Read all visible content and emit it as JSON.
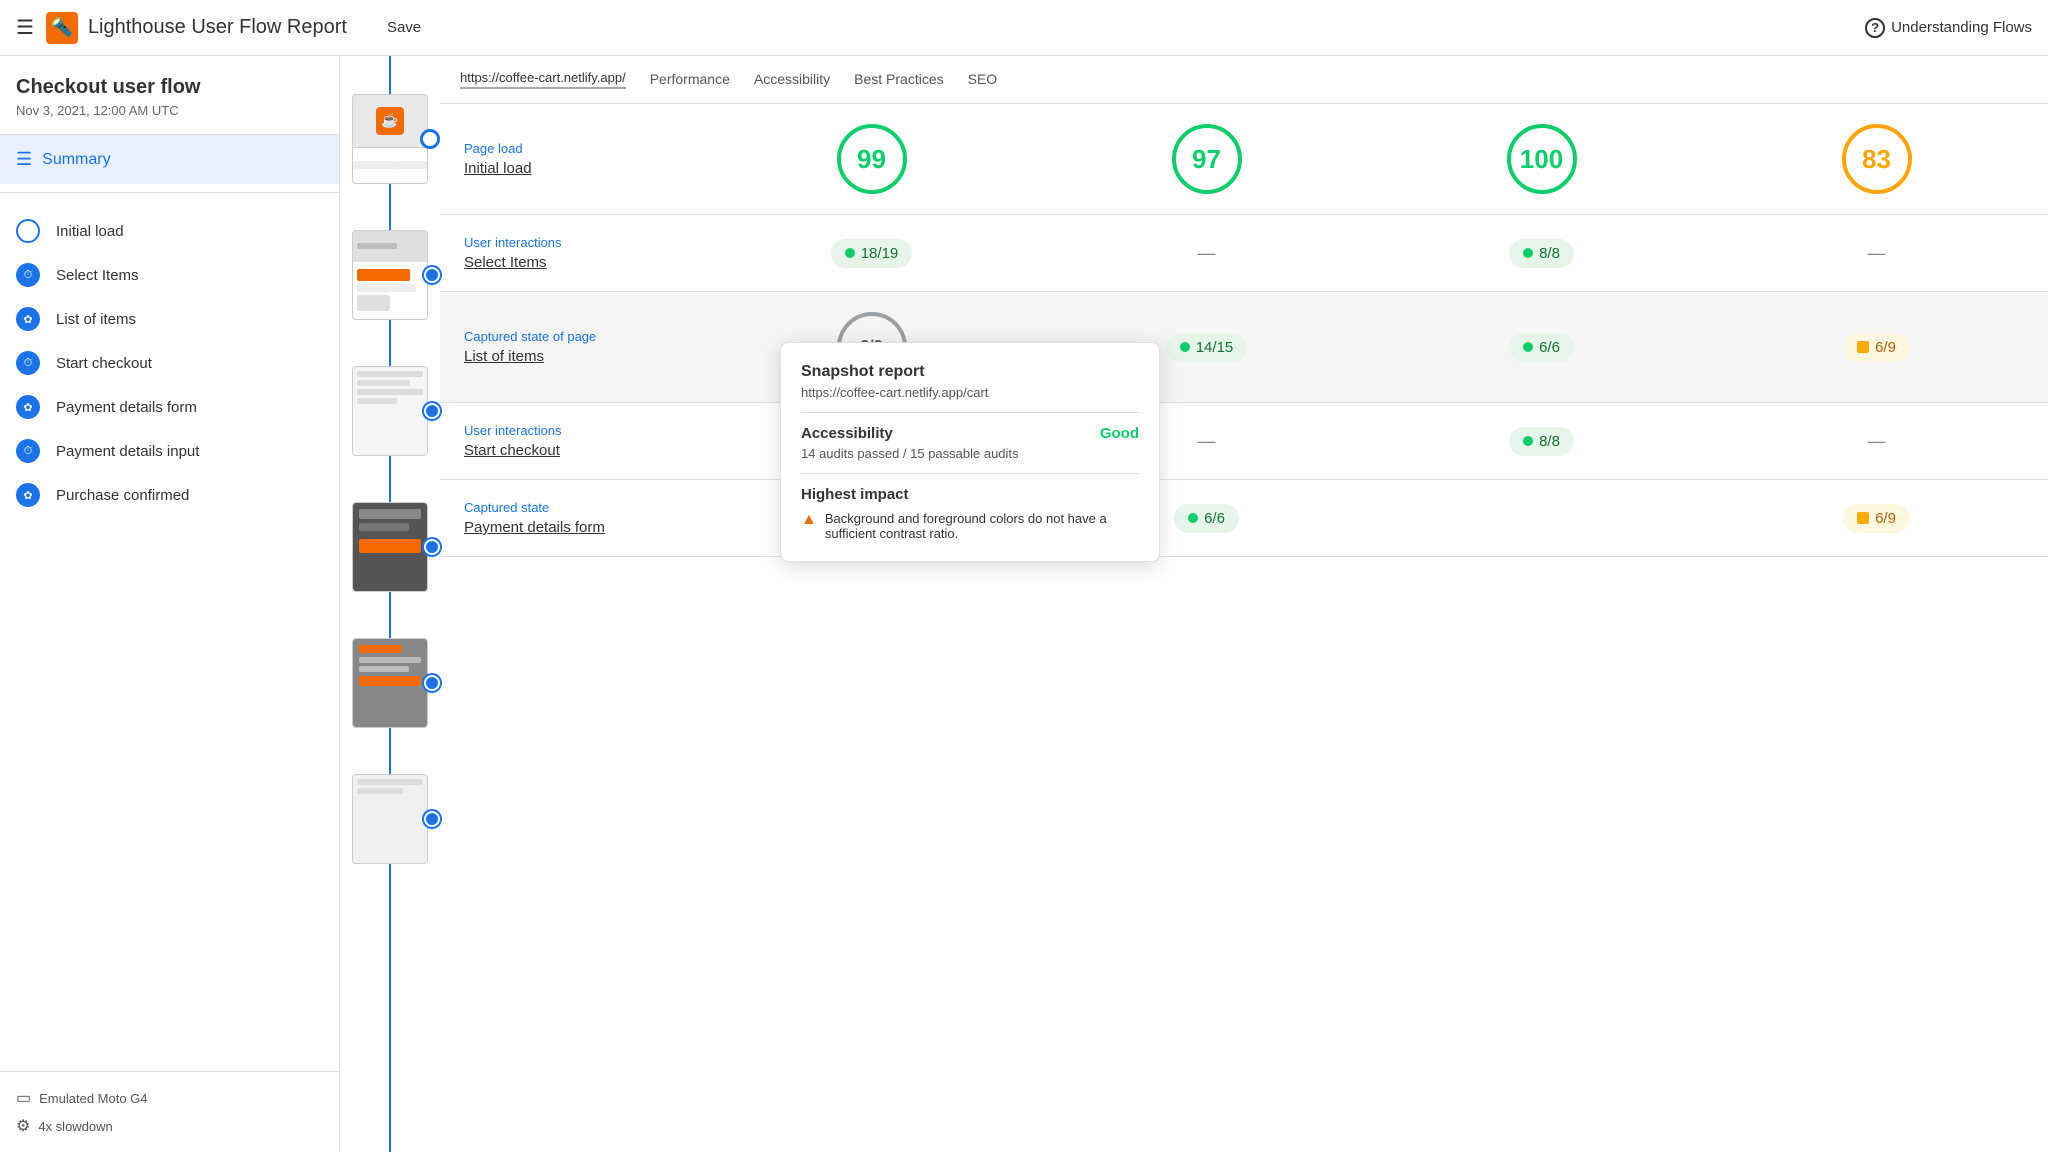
{
  "header": {
    "menu_label": "☰",
    "logo_icon": "🔍",
    "title": "Lighthouse User Flow Report",
    "save_label": "Save",
    "help_label": "Understanding Flows"
  },
  "sidebar": {
    "flow_title": "Checkout user flow",
    "flow_date": "Nov 3, 2021, 12:00 AM UTC",
    "summary_label": "Summary",
    "steps": [
      {
        "label": "Initial load",
        "type": "circle"
      },
      {
        "label": "Select Items",
        "type": "clock"
      },
      {
        "label": "List of items",
        "type": "camera"
      },
      {
        "label": "Start checkout",
        "type": "clock"
      },
      {
        "label": "Payment details form",
        "type": "camera"
      },
      {
        "label": "Payment details input",
        "type": "clock"
      },
      {
        "label": "Purchase confirmed",
        "type": "camera"
      }
    ],
    "device_label": "Emulated Moto G4",
    "slowdown_label": "4x slowdown"
  },
  "tabs": {
    "url": "https://coffee-cart.netlify.app/",
    "items": [
      "Performance",
      "Accessibility",
      "Best Practices",
      "SEO"
    ]
  },
  "sections": [
    {
      "type": "Page load",
      "name": "Initial load",
      "timeline_type": "circle",
      "scores": {
        "performance": {
          "value": 99,
          "color": "green"
        },
        "accessibility": {
          "value": 97,
          "color": "green"
        },
        "best_practices": {
          "value": 100,
          "color": "green"
        },
        "seo": {
          "value": 83,
          "color": "orange"
        }
      }
    },
    {
      "type": "User interactions",
      "name": "Select Items",
      "timeline_type": "clock",
      "scores": {
        "performance": {
          "badge": "18/19",
          "color": "green"
        },
        "accessibility": {
          "dash": true
        },
        "best_practices": {
          "badge": "8/8",
          "color": "green"
        },
        "seo": {
          "dash": true
        }
      }
    },
    {
      "type": "Captured state of page",
      "name": "List of items",
      "timeline_type": "camera",
      "highlighted": true,
      "scores": {
        "performance": {
          "badge": "3/3",
          "color": "grey"
        },
        "accessibility": {
          "badge": "14/15",
          "color": "green"
        },
        "best_practices": {
          "badge": "6/6",
          "color": "green"
        },
        "seo": {
          "badge": "6/9",
          "color": "orange"
        }
      }
    },
    {
      "type": "User interactions",
      "name": "Start checkout",
      "timeline_type": "clock",
      "scores": {
        "performance": {
          "badge_hidden": true
        },
        "accessibility": {
          "dash": true
        },
        "best_practices": {
          "badge": "8/8",
          "color": "green"
        },
        "seo": {
          "dash": true
        }
      }
    },
    {
      "type": "Captured state",
      "name": "Payment details form",
      "timeline_type": "camera",
      "scores": {
        "performance": {
          "badge_hidden": true
        },
        "accessibility": {
          "badge": "6/6",
          "color": "green"
        },
        "best_practices": {
          "badge_hidden": true
        },
        "seo": {
          "badge": "6/9",
          "color": "orange"
        }
      }
    }
  ],
  "tooltip": {
    "title": "Snapshot report",
    "url": "https://coffee-cart.netlify.app/cart",
    "accessibility_label": "Accessibility",
    "accessibility_value": "Good",
    "accessibility_desc": "14 audits passed / 15 passable audits",
    "highest_impact_label": "Highest impact",
    "impact_item": "Background and foreground colors do not have a sufficient contrast ratio."
  },
  "icons": {
    "menu": "☰",
    "list": "☰",
    "clock": "⏱",
    "camera": "✿",
    "device": "▭",
    "slowdown": "⚙",
    "help": "?"
  }
}
